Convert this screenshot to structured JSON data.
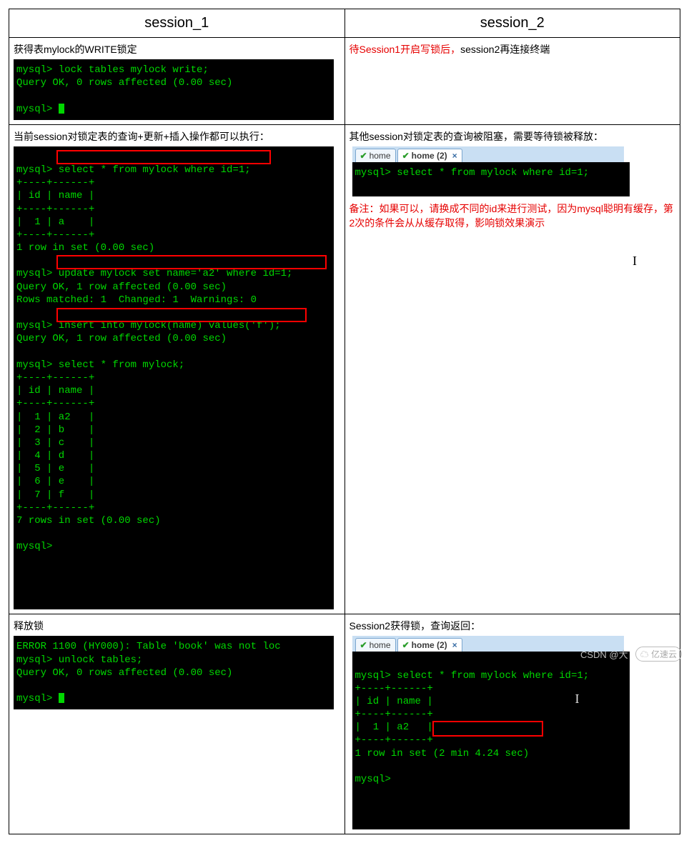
{
  "headers": {
    "s1": "session_1",
    "s2": "session_2"
  },
  "row1": {
    "s1_desc": "获得表mylock的WRITE锁定",
    "s1_term": "mysql> lock tables mylock write;\nQuery OK, 0 rows affected (0.00 sec)\n\nmysql> ",
    "s2_desc_red": "待Session1开启写锁后，",
    "s2_desc_black": "session2再连接终端"
  },
  "row2": {
    "s1_desc": "当前session对锁定表的查询+更新+插入操作都可以执行：",
    "s1_term": "mysql> select * from mylock where id=1;\n+----+------+\n| id | name |\n+----+------+\n|  1 | a    |\n+----+------+\n1 row in set (0.00 sec)\n\nmysql> update mylock set name='a2' where id=1;\nQuery OK, 1 row affected (0.00 sec)\nRows matched: 1  Changed: 1  Warnings: 0\n\nmysql> insert into mylock(name) values('f');\nQuery OK, 1 row affected (0.00 sec)\n\nmysql> select * from mylock;\n+----+------+\n| id | name |\n+----+------+\n|  1 | a2   |\n|  2 | b    |\n|  3 | c    |\n|  4 | d    |\n|  5 | e    |\n|  6 | e    |\n|  7 | f    |\n+----+------+\n7 rows in set (0.00 sec)\n\nmysql>",
    "s2_desc": "其他session对锁定表的查询被阻塞，需要等待锁被释放：",
    "tab1": "home",
    "tab2": "home (2)",
    "s2_term": "mysql> select * from mylock where id=1;\n\n",
    "s2_note": "备注：如果可以，请换成不同的id来进行测试，因为mysql聪明有缓存，第2次的条件会从从缓存取得，影响锁效果演示"
  },
  "row3": {
    "s1_desc": "释放锁",
    "s1_term": "ERROR 1100 (HY000): Table 'book' was not loc\nmysql> unlock tables;\nQuery OK, 0 rows affected (0.00 sec)\n\nmysql> ",
    "s2_desc": "Session2获得锁，查询返回：",
    "tab1": "home",
    "tab2": "home (2)",
    "s2_term": "mysql> select * from mylock where id=1;\n+----+------+\n| id | name |\n+----+------+\n|  1 | a2   |\n+----+------+\n1 row in set (2 min 4.24 sec)\n\nmysql>"
  },
  "watermark": {
    "csdn": "CSDN @大",
    "yisu": "亿速云"
  }
}
